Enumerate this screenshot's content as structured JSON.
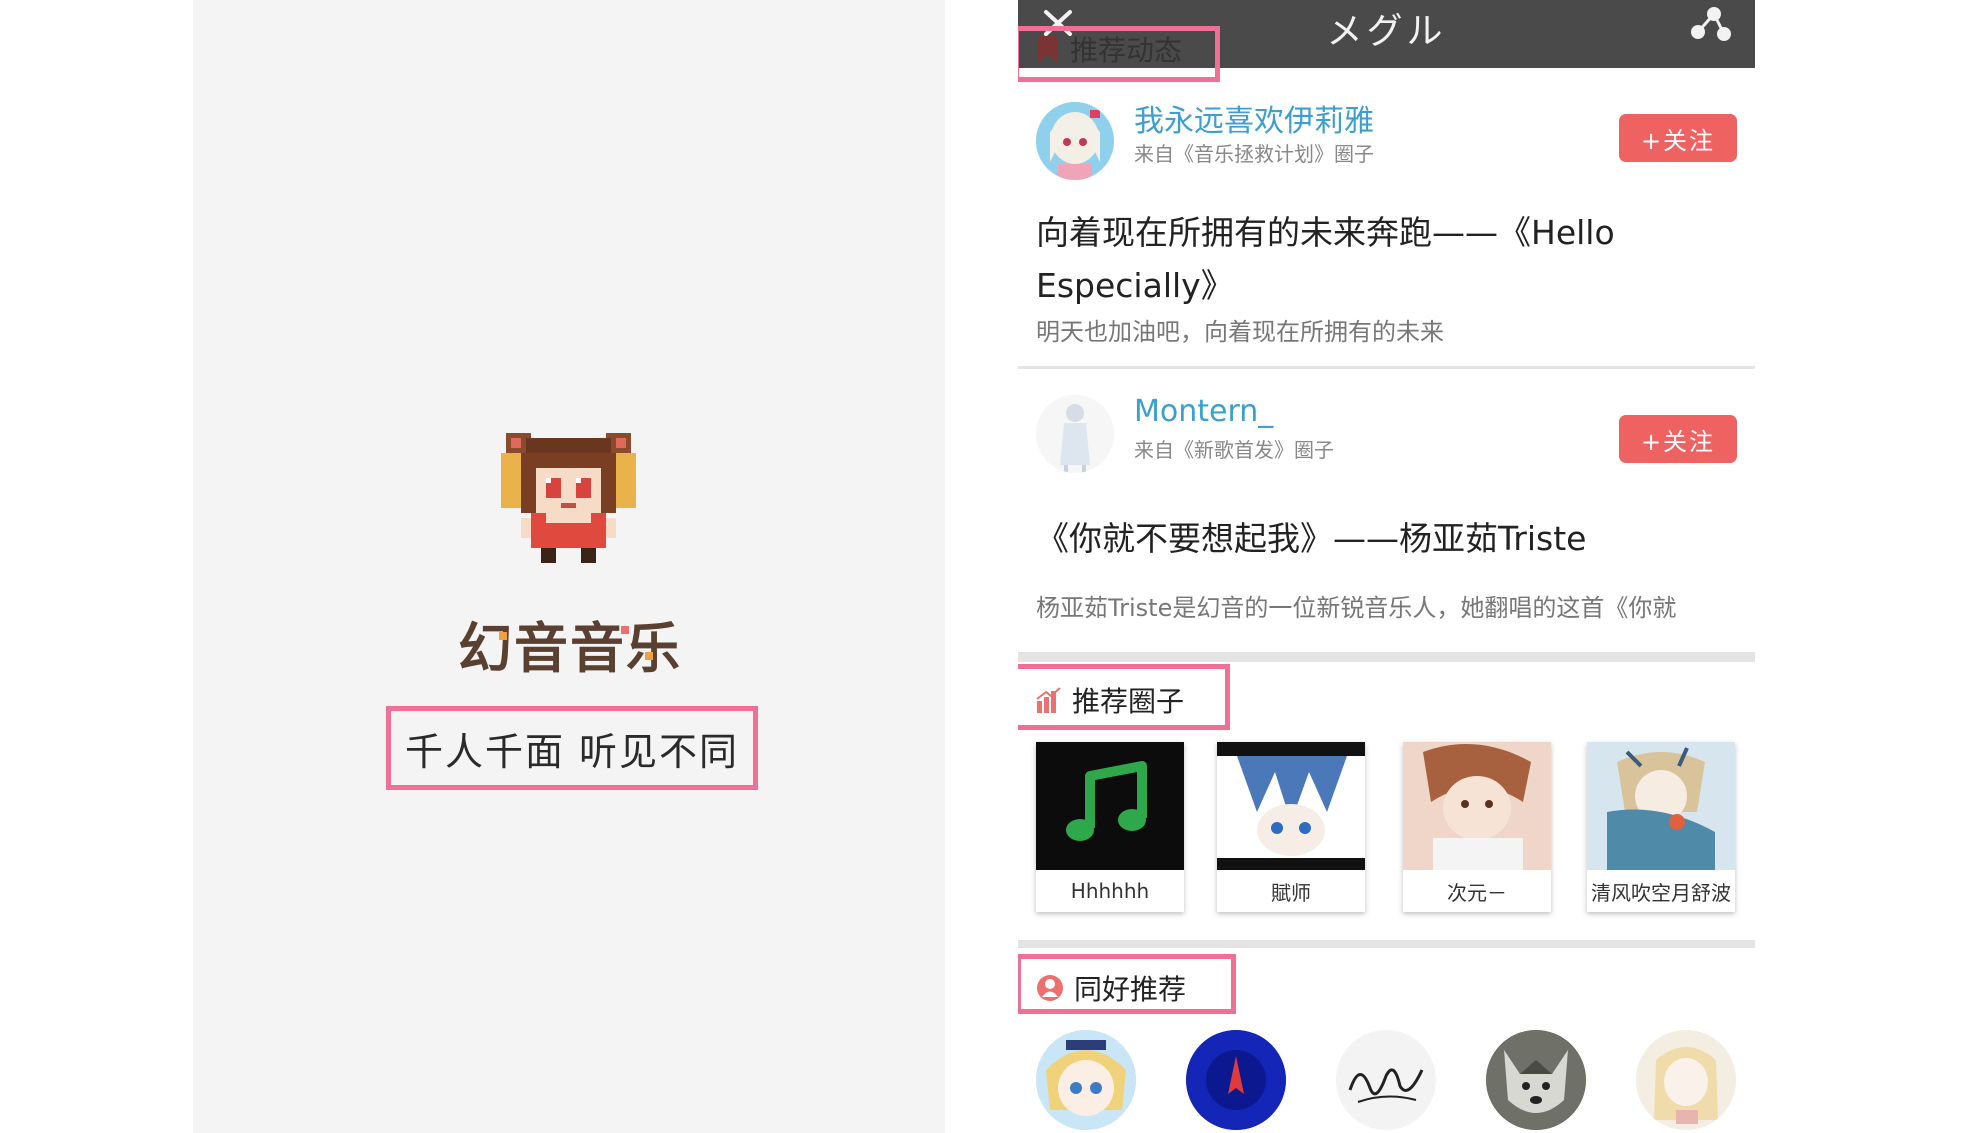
{
  "splash": {
    "logo_text": "幻音音乐",
    "slogan": "千人千面 听见不同"
  },
  "app": {
    "title": "メグル",
    "sections": {
      "recommended_posts": "推荐动态",
      "recommended_circles": "推荐圈子",
      "similar_users": "同好推荐"
    },
    "posts": [
      {
        "username": "我永远喜欢伊莉雅",
        "from": "来自《音乐拯救计划》圈子",
        "follow_label": "+关注",
        "title_line1": "向着现在所拥有的未来奔跑——《Hello",
        "title_line2": "Especially》",
        "desc": "明天也加油吧，向着现在所拥有的未来"
      },
      {
        "username": "Montern_",
        "from": "来自《新歌首发》圈子",
        "follow_label": "+关注",
        "title_line1": "《你就不要想起我》——杨亚茹Triste",
        "desc": "杨亚茹Triste是幻音的一位新锐音乐人，她翻唱的这首《你就"
      }
    ],
    "circles": [
      {
        "name": "Hhhhhh",
        "icon": "music-note-icon"
      },
      {
        "name": "賦师"
      },
      {
        "name": "次元－"
      },
      {
        "name": "清风吹空月舒波"
      }
    ],
    "colors": {
      "accent_pink": "#ef6f95",
      "follow_red": "#ee6262",
      "username_blue": "#3d9fcf",
      "titlebar": "#4a4a4a"
    }
  }
}
